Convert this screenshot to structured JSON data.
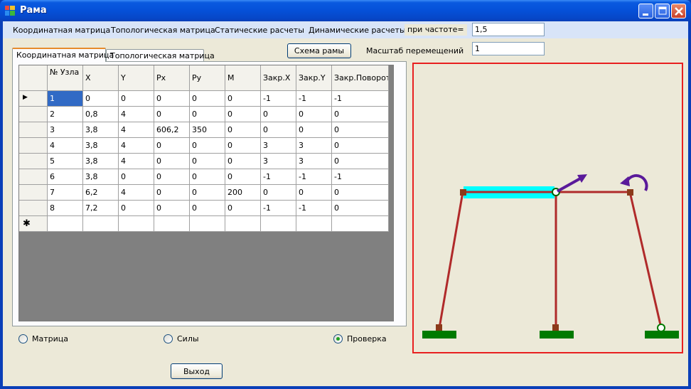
{
  "window": {
    "title": "Рама"
  },
  "menu": {
    "items": [
      "Координатная матрица",
      "Топологическая матрица",
      "Статические расчеты",
      "Динамические расчеты"
    ],
    "frequency_label": "при частоте=",
    "frequency_value": "1,5"
  },
  "toolbar": {
    "scheme_button": "Схема рамы",
    "scale_label": "Масштаб перемещений",
    "scale_value": "1"
  },
  "tabs": [
    {
      "label": "Координатная матрица",
      "active": true
    },
    {
      "label": "Топологическая матрица",
      "active": false
    }
  ],
  "grid": {
    "columns": [
      "№ Узла",
      "X",
      "Y",
      "Px",
      "Py",
      "M",
      "Закр.X",
      "Закр.Y",
      "Закр.Поворот"
    ],
    "rows": [
      [
        "1",
        "0",
        "0",
        "0",
        "0",
        "0",
        "-1",
        "-1",
        "-1"
      ],
      [
        "2",
        "0,8",
        "4",
        "0",
        "0",
        "0",
        "0",
        "0",
        "0"
      ],
      [
        "3",
        "3,8",
        "4",
        "606,2",
        "350",
        "0",
        "0",
        "0",
        "0"
      ],
      [
        "4",
        "3,8",
        "4",
        "0",
        "0",
        "0",
        "3",
        "3",
        "0"
      ],
      [
        "5",
        "3,8",
        "4",
        "0",
        "0",
        "0",
        "3",
        "3",
        "0"
      ],
      [
        "6",
        "3,8",
        "0",
        "0",
        "0",
        "0",
        "-1",
        "-1",
        "-1"
      ],
      [
        "7",
        "6,2",
        "4",
        "0",
        "0",
        "200",
        "0",
        "0",
        "0"
      ],
      [
        "8",
        "7,2",
        "0",
        "0",
        "0",
        "0",
        "-1",
        "-1",
        "0"
      ]
    ],
    "new_row_marker": "✱",
    "current_row_marker": "▶"
  },
  "radios": [
    {
      "label": "Матрица",
      "checked": false
    },
    {
      "label": "Силы",
      "checked": false
    },
    {
      "label": "Проверка",
      "checked": true
    }
  ],
  "exit_button": "Выход",
  "colors": {
    "frame_member": "#b02a2a",
    "support": "#007a00",
    "highlight_member": "#00ffff",
    "force_arrow": "#5a1a9a",
    "canvas_border": "#e82020"
  },
  "icons": {
    "minimize": "minimize-icon",
    "maximize": "maximize-icon",
    "close": "close-icon",
    "app": "app-icon"
  }
}
